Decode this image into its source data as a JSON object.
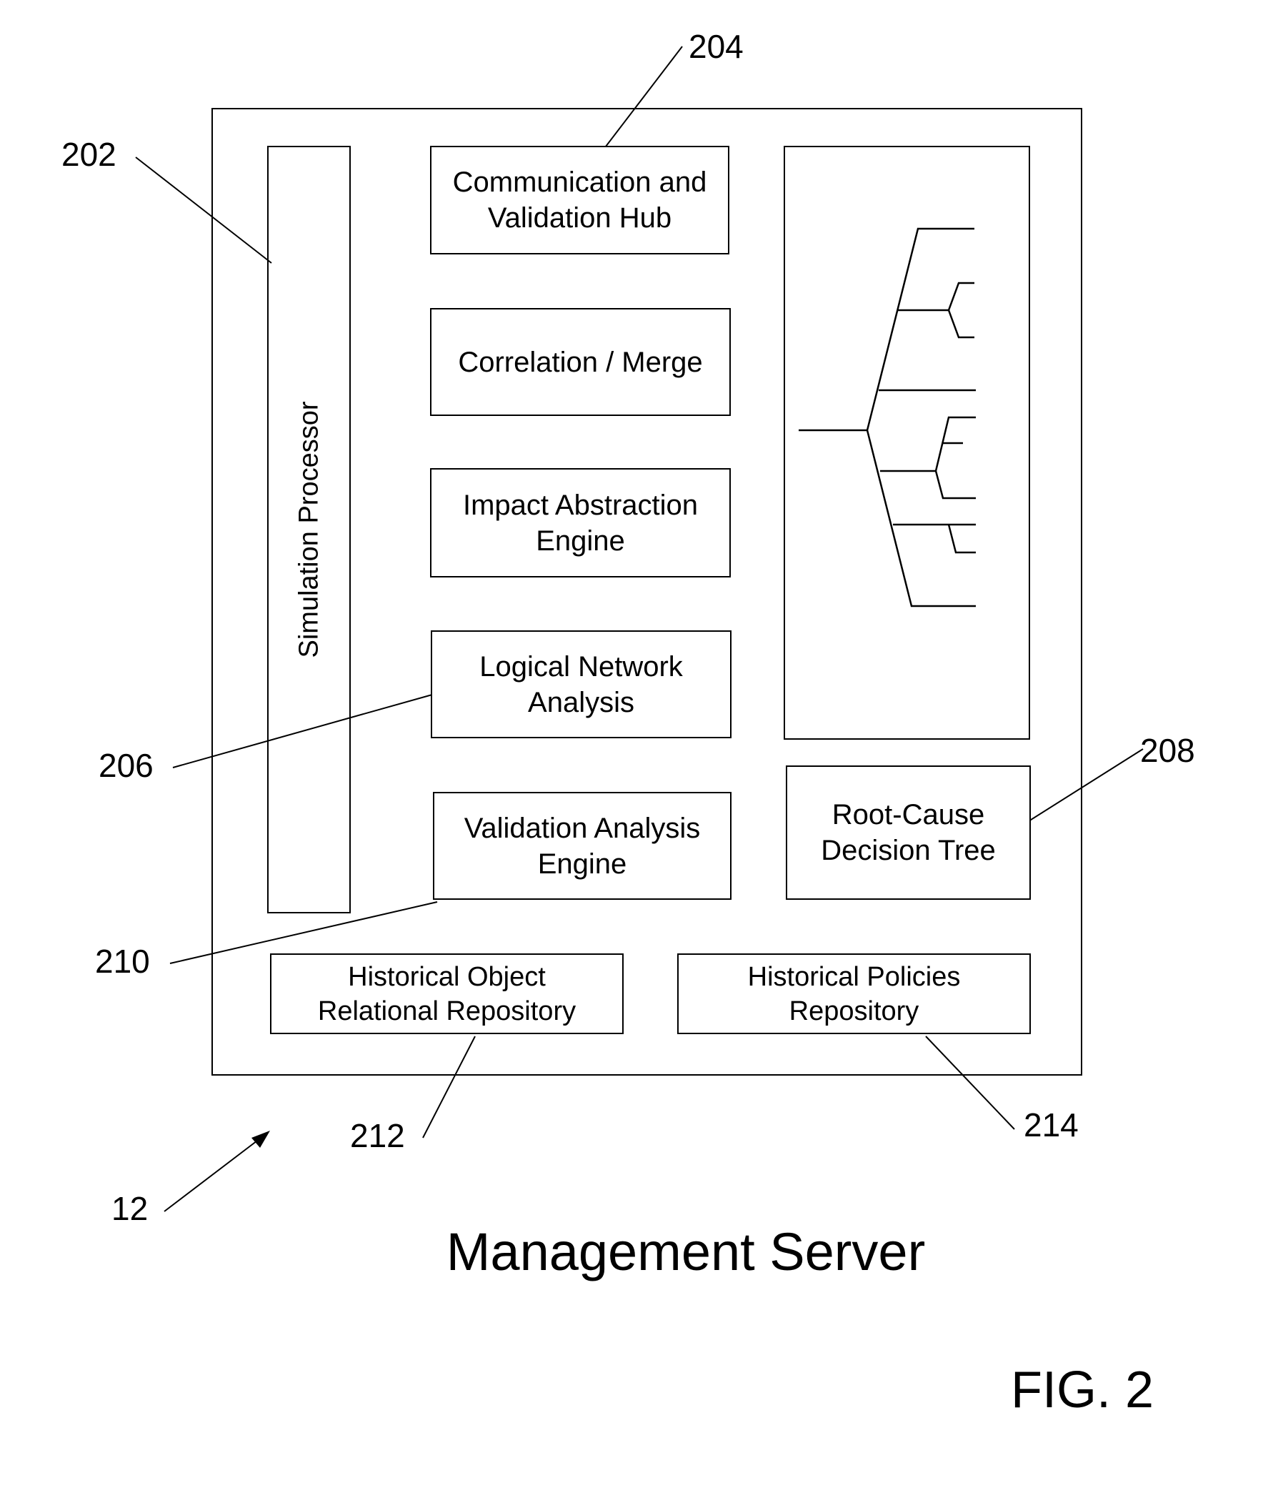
{
  "figure": {
    "title": "Management Server",
    "label": "FIG. 2",
    "system_ref": "12"
  },
  "components": {
    "simulation_processor": {
      "label": "Simulation Processor",
      "ref": "202"
    },
    "communication_hub": {
      "label": "Communication and\nValidation Hub",
      "ref": "204"
    },
    "correlation_merge": {
      "label": "Correlation / Merge"
    },
    "impact_abstraction": {
      "label": "Impact Abstraction\nEngine"
    },
    "logical_network": {
      "label": "Logical Network\nAnalysis",
      "ref": "206"
    },
    "validation_analysis": {
      "label": "Validation Analysis\nEngine",
      "ref": "210"
    },
    "decision_tree_graphic": {
      "icon": "decision-tree-icon"
    },
    "root_cause": {
      "label": "Root-Cause\nDecision Tree",
      "ref": "208"
    },
    "historical_object": {
      "label": "Historical Object\nRelational Repository",
      "ref": "212"
    },
    "historical_policies": {
      "label": "Historical Policies\nRepository",
      "ref": "214"
    }
  }
}
